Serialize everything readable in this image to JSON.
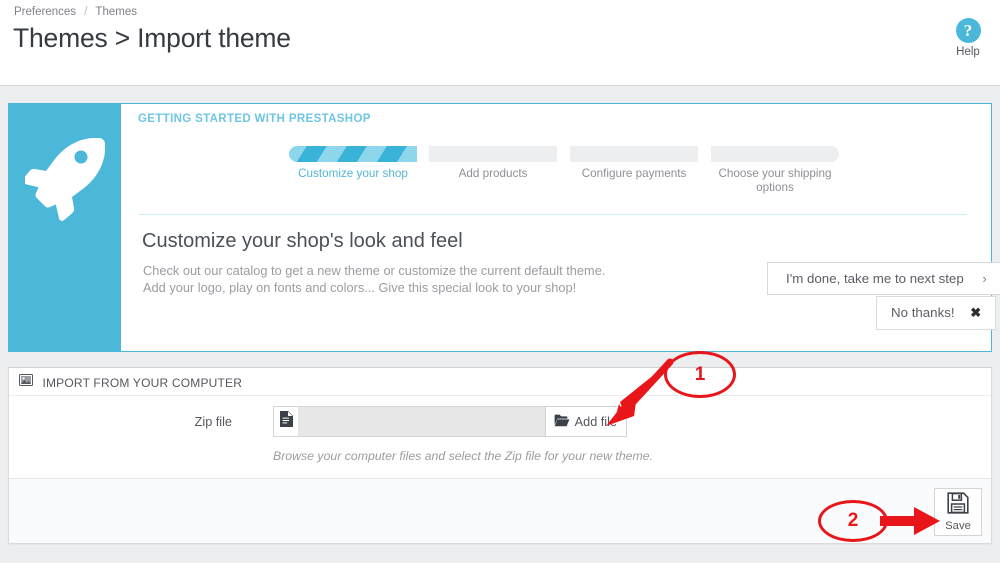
{
  "header": {
    "breadcrumb": {
      "parent": "Preferences",
      "separator": "/",
      "current": "Themes"
    },
    "title": "Themes > Import theme",
    "help": {
      "label": "Help",
      "icon": "question-mark-circle-icon",
      "glyph": "?"
    }
  },
  "getting_started": {
    "kicker": "GETTING STARTED WITH PRESTASHOP",
    "side_icon": "rocket-icon",
    "accent_color": "#4bb8da",
    "steps": [
      {
        "label": "Customize your shop",
        "state": "active"
      },
      {
        "label": "Add products",
        "state": "inactive"
      },
      {
        "label": "Configure payments",
        "state": "inactive"
      },
      {
        "label": "Choose your shipping options",
        "state": "inactive"
      }
    ],
    "heading": "Customize your shop's look and feel",
    "description_line1": "Check out our catalog to get a new theme or customize the current default theme.",
    "description_line2": "Add your logo, play on fonts and colors... Give this special look to your shop!",
    "primary_button": {
      "label": "I'm done, take me to next step",
      "icon": "chevron-right-icon",
      "glyph": "›"
    },
    "secondary_button": {
      "label": "No thanks!",
      "icon": "close-x-icon",
      "glyph": "✖"
    }
  },
  "import_panel": {
    "title": "IMPORT FROM YOUR COMPUTER",
    "title_icon": "picture-icon",
    "field": {
      "label": "Zip file",
      "value": "",
      "placeholder": "",
      "prefix_icon": "file-document-icon",
      "browse_button": {
        "label": "Add file",
        "icon": "folder-open-icon"
      }
    },
    "hint": "Browse your computer files and select the Zip file for your new theme.",
    "save_button": {
      "label": "Save",
      "icon": "floppy-disk-icon"
    }
  },
  "annotations": {
    "color": "#e8161a",
    "markers": [
      {
        "number": "1",
        "points_to": "add-file-button"
      },
      {
        "number": "2",
        "points_to": "save-button"
      }
    ]
  }
}
